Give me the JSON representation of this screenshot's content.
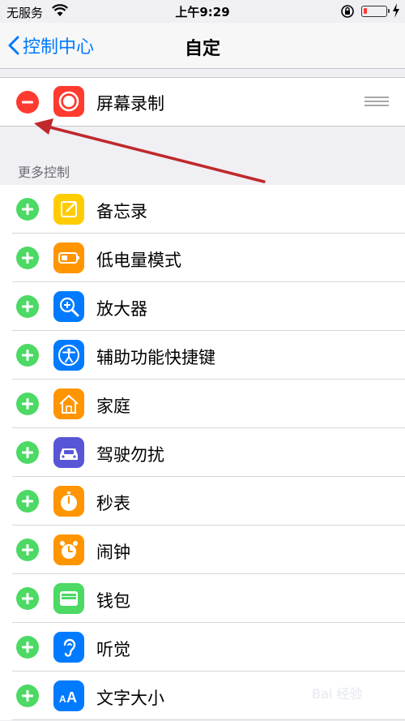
{
  "status_bar": {
    "carrier": "无服务",
    "time": "上午9:29",
    "battery_level": 0.15
  },
  "nav": {
    "back_label": "控制中心",
    "title": "自定"
  },
  "included": [
    {
      "label": "屏幕录制",
      "icon": "screen-record-icon",
      "color": "#ff3b30"
    }
  ],
  "more_controls": {
    "header": "更多控制",
    "items": [
      {
        "label": "备忘录",
        "icon": "notes-icon",
        "color": "#ffcc00"
      },
      {
        "label": "低电量模式",
        "icon": "low-power-battery-icon",
        "color": "#ff9500"
      },
      {
        "label": "放大器",
        "icon": "magnifier-icon",
        "color": "#007aff"
      },
      {
        "label": "辅助功能快捷键",
        "icon": "accessibility-icon",
        "color": "#007aff"
      },
      {
        "label": "家庭",
        "icon": "home-icon",
        "color": "#ff9500"
      },
      {
        "label": "驾驶勿扰",
        "icon": "car-icon",
        "color": "#5856d6"
      },
      {
        "label": "秒表",
        "icon": "stopwatch-icon",
        "color": "#ff9500"
      },
      {
        "label": "闹钟",
        "icon": "alarm-icon",
        "color": "#ff9500"
      },
      {
        "label": "钱包",
        "icon": "wallet-icon",
        "color": "#4cd964"
      },
      {
        "label": "听觉",
        "icon": "ear-icon",
        "color": "#007aff"
      },
      {
        "label": "文字大小",
        "icon": "text-size-icon",
        "color": "#007aff"
      }
    ]
  },
  "watermark": "Bai 经验"
}
